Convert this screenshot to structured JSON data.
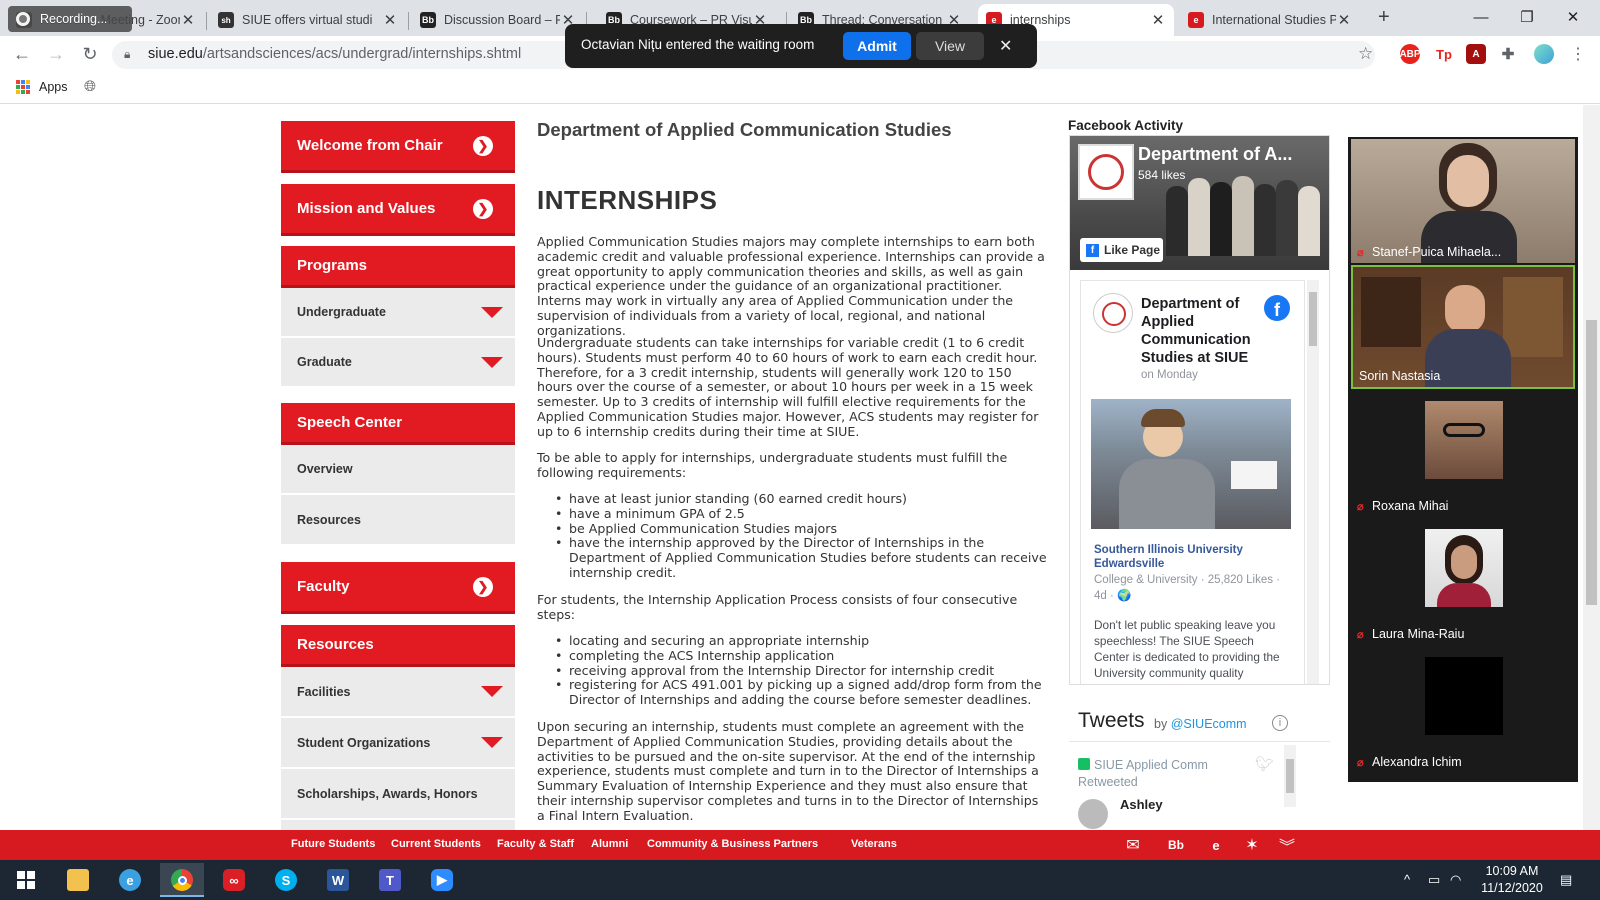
{
  "browser": {
    "recording_label": "Recording...",
    "tabs": [
      {
        "title": "Recording Meeting - Zoom",
        "icon": "zoom-icon",
        "color": "#4a4a4a"
      },
      {
        "title": "SIUE offers virtual studi",
        "icon": "siue-icon",
        "color": "#333333"
      },
      {
        "title": "Discussion Board – PR",
        "icon": "blackboard-icon",
        "color": "#222222"
      },
      {
        "title": "Coursework – PR Visua",
        "icon": "blackboard-icon",
        "color": "#222222"
      },
      {
        "title": "Thread: Conversation",
        "icon": "blackboard-icon",
        "color": "#222222"
      },
      {
        "title": "internships",
        "icon": "siue-icon",
        "color": "#d71920"
      },
      {
        "title": "International Studies P",
        "icon": "siue-icon",
        "color": "#d71920"
      }
    ],
    "url_host": "siue.edu",
    "url_path": "/artsandsciences/acs/undergrad/internships.shtml",
    "bookmarks": {
      "apps_label": "Apps"
    }
  },
  "zoom_notice": {
    "message": "Octavian Nițu entered the waiting room",
    "admit_label": "Admit",
    "view_label": "View"
  },
  "sidebar": {
    "welcome": "Welcome from Chair",
    "mission": "Mission and Values",
    "programs": "Programs",
    "undergraduate": "Undergraduate",
    "graduate": "Graduate",
    "speech_center": "Speech Center",
    "overview": "Overview",
    "resources_sub": "Resources",
    "faculty": "Faculty",
    "resources": "Resources",
    "facilities": "Facilities",
    "student_orgs": "Student Organizations",
    "scholarships": "Scholarships, Awards, Honors"
  },
  "content": {
    "dept_title": "Department of Applied Communication Studies",
    "heading": "INTERNSHIPS",
    "p1": "Applied Communication Studies majors may complete internships to earn both academic credit and valuable professional experience. Internships can provide a great opportunity to apply communication theories and skills, as well as gain practical experience under the guidance of an organizational practitioner. Interns may work in virtually any area of Applied Communication under the supervision of individuals from a variety of local, regional, and national organizations.",
    "p2": "Undergraduate students can take internships for variable credit (1 to 6 credit hours). Students must perform 40 to 60 hours of work to earn each credit hour. Therefore, for a 3 credit internship, students will generally work 120 to 150 hours over the course of a semester, or about 10 hours per week in a 15 week semester. Up to 3 credits of internship will fulfill elective requirements for the Applied Communication Studies major. However, ACS students may register for up to 6 internship credits during their time at SIUE.",
    "p3": "To be able to apply for internships, undergraduate students must fulfill the following requirements:",
    "requirements": [
      "have at least junior standing (60 earned credit hours)",
      "have a minimum GPA of 2.5",
      "be Applied Communication Studies majors",
      "have the internship approved by the Director of Internships in the Department of Applied Communication Studies before students can receive internship credit."
    ],
    "p4": "For students, the Internship Application Process consists of four consecutive steps:",
    "steps": [
      "locating and securing an appropriate internship",
      "completing the ACS Internship application",
      "receiving approval from the Internship Director for internship credit",
      "registering for ACS 491.001 by picking up a signed add/drop form from the Director of Internships and adding the course before semester deadlines."
    ],
    "p5": "Upon securing an internship, students must complete an agreement with the Department of Applied Communication Studies, providing details about the activities to be pursued and the on-site supervisor. At the end of the internship experience, students must complete and turn in to the Director of Internships a Summary Evaluation of Internship Experience and they must also ensure that their internship supervisor completes and turns in to the Director of Internships a Final Intern Evaluation."
  },
  "facebook": {
    "section_label": "Facebook Activity",
    "page_name": "Department of A...",
    "likes": "584 likes",
    "like_button": "Like Page",
    "post_author": "Department of Applied Communication Studies at SIUE",
    "post_time": "on Monday",
    "shared_name": "Southern Illinois University Edwardsville",
    "shared_meta": "College & University · 25,820 Likes · 4d · 🌍",
    "post_text": "Don't let public speaking leave you speechless! The SIUE Speech Center is dedicated to providing the University community quality assistance in"
  },
  "tweets": {
    "title": "Tweets",
    "by_prefix": "by ",
    "handle": "@SIUEcomm",
    "retweeter": "SIUE Applied Comm",
    "retweeted": "Retweeted",
    "author": "Ashley"
  },
  "gallery": {
    "participants": [
      {
        "name": "Stanef-Puica Mihaela...",
        "type": "video"
      },
      {
        "name": "Sorin Nastasia",
        "type": "video"
      },
      {
        "name": "Roxana Mihai",
        "type": "avatar"
      },
      {
        "name": "Laura Mina-Raiu",
        "type": "avatar"
      },
      {
        "name": "Alexandra Ichim",
        "type": "blank"
      }
    ]
  },
  "footer": {
    "links": [
      "Future Students",
      "Current Students",
      "Faculty & Staff",
      "Alumni",
      "Community & Business Partners",
      "Veterans"
    ],
    "icons": [
      "mail-icon",
      "blackboard-icon",
      "cougarnet-icon",
      "star-icon",
      "chevrons-down-icon"
    ]
  },
  "taskbar": {
    "time": "10:09 AM",
    "date": "11/12/2020",
    "apps": [
      "file-explorer-icon",
      "internet-explorer-icon",
      "chrome-icon",
      "creative-cloud-icon",
      "skype-icon",
      "word-icon",
      "teams-icon",
      "zoom-icon"
    ]
  },
  "colors": {
    "siue_red": "#e21a22",
    "footer_red": "#d71920",
    "zoom_blue": "#0e71eb",
    "facebook_blue": "#1877f2"
  }
}
